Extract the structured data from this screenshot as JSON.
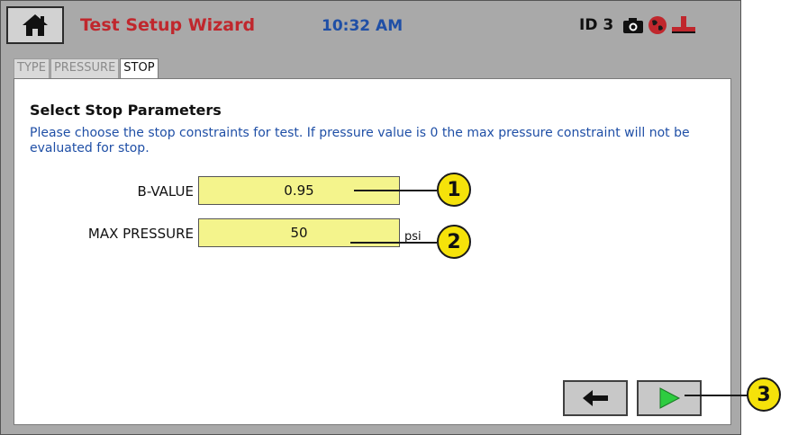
{
  "header": {
    "home_icon": "home-icon",
    "title": "Test Setup Wizard",
    "time": "10:32 AM",
    "device_id": "ID 3",
    "status_icons": [
      "camera-icon",
      "globe-icon",
      "network-icon"
    ]
  },
  "tabs": [
    {
      "label": "TYPE",
      "active": false
    },
    {
      "label": "PRESSURE",
      "active": false
    },
    {
      "label": "STOP",
      "active": true
    }
  ],
  "panel": {
    "title": "Select Stop Parameters",
    "instructions": "Please choose the stop constraints for test.  If pressure value is 0 the max pressure constraint will not be evaluated for stop.",
    "fields": [
      {
        "label": "B-VALUE",
        "value": "0.95",
        "unit": ""
      },
      {
        "label": "MAX PRESSURE",
        "value": "50",
        "unit": "psi"
      }
    ]
  },
  "navigation": {
    "back_icon": "arrow-left-icon",
    "next_icon": "play-icon"
  },
  "callouts": [
    "1",
    "2",
    "3"
  ],
  "colors": {
    "title_red": "#c0272d",
    "clock_blue": "#1f4fa6",
    "input_yellow": "#f4f48c",
    "callout_yellow": "#f5e20a",
    "next_green": "#2ecc40"
  }
}
